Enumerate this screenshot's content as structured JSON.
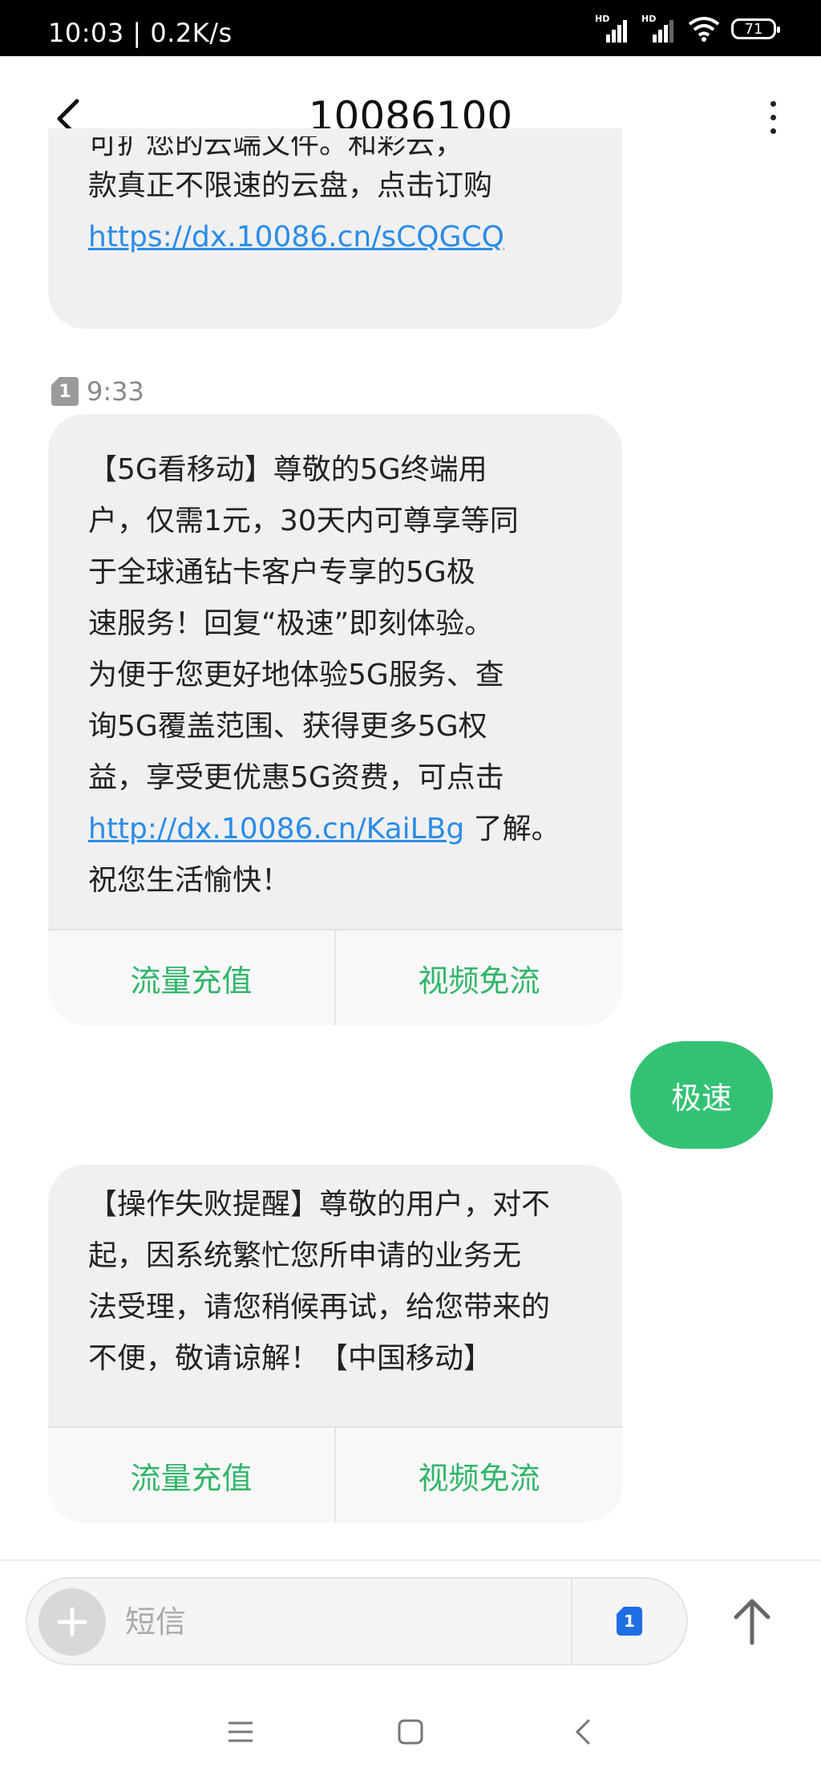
{
  "status_bar": {
    "time": "10:03 | 0.2K/s",
    "signal_label": "HD",
    "battery": "71"
  },
  "header": {
    "title": "10086100"
  },
  "messages": [
    {
      "lines": [
        "可扩您的云端文件。和彩云，",
        "款真正不限速的云盘，点击订购"
      ],
      "link": "https://dx.10086.cn/sCQGCQ"
    },
    {
      "sim": "1",
      "time": "9:33",
      "lines": [
        "【5G看移动】尊敬的5G终端用",
        "户，仅需1元，30天内可尊享等同",
        "于全球通钻卡客户专享的5G极",
        "速服务！回复“极速”即刻体验。",
        "为便于您更好地体验5G服务、查",
        "询5G覆盖范围、获得更多5G权",
        "益，享受更优惠5G资费，可点击"
      ],
      "link": "http://dx.10086.cn/KaiLBg",
      "after_link": " 了解。",
      "last_line": "祝您生活愉快！",
      "actions": [
        "流量充值",
        "视频免流"
      ]
    },
    {
      "sent_text": "极速"
    },
    {
      "lines": [
        "【操作失败提醒】尊敬的用户，对不",
        "起，因系统繁忙您所申请的业务无",
        "法受理，请您稍候再试，给您带来的",
        "不便，敬请谅解！【中国移动】"
      ],
      "actions": [
        "流量充值",
        "视频免流"
      ]
    }
  ],
  "input": {
    "placeholder": "短信",
    "sim": "1"
  },
  "colors": {
    "accent_green": "#33c274",
    "action_green": "#32b56a",
    "link_blue": "#2b8ce6",
    "sim_blue": "#1e6fe3"
  }
}
